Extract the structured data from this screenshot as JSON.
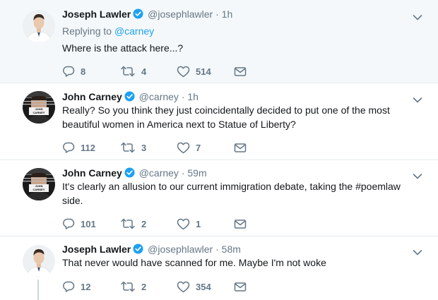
{
  "tweets": [
    {
      "name": "Joseph Lawler",
      "handle": "@josephlawler",
      "time": "1h",
      "reply_prefix": "Replying to",
      "reply_mention": "@carney",
      "text": "Where is the attack here...?",
      "replies": "8",
      "retweets": "4",
      "likes": "514"
    },
    {
      "name": "John Carney",
      "handle": "@carney",
      "time": "1h",
      "text": "Really? So you think they just coincidentally decided to put one of the most beautiful women in America next to Statue of Liberty?",
      "replies": "112",
      "retweets": "3",
      "likes": "7"
    },
    {
      "name": "John Carney",
      "handle": "@carney",
      "time": "59m",
      "text": "It's clearly an allusion to our current immigration debate, taking the #poemlaw side.",
      "replies": "101",
      "retweets": "2",
      "likes": "1"
    },
    {
      "name": "Joseph Lawler",
      "handle": "@josephlawler",
      "time": "58m",
      "text": "That never would have scanned for me. Maybe I'm not woke",
      "replies": "12",
      "retweets": "2",
      "likes": "354"
    }
  ],
  "avatar_labels": {
    "carney": "JOHN CARNEY"
  },
  "colors": {
    "accent": "#1da1f2",
    "muted": "#657786",
    "thread_line": "#ccd6dd",
    "highlight_bg": "#f5f8fa"
  },
  "icons": [
    "verified-badge-icon",
    "chevron-down-icon",
    "reply-icon",
    "retweet-icon",
    "like-icon",
    "direct-message-icon"
  ]
}
